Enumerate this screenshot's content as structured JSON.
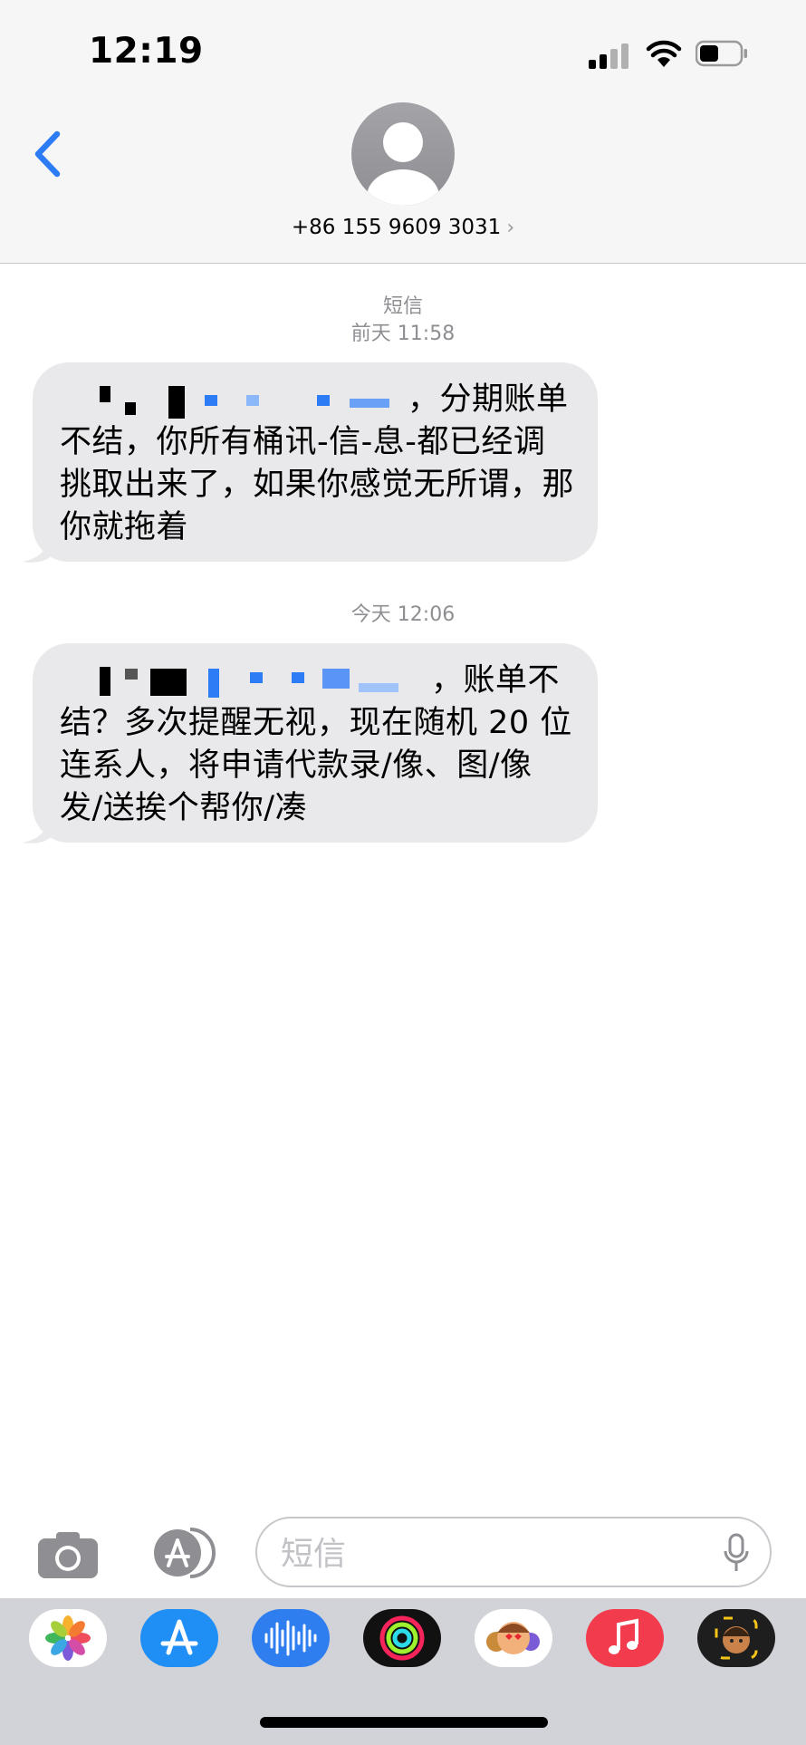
{
  "status_bar": {
    "time": "12:19"
  },
  "header": {
    "contact": "+86 155 9609 3031",
    "chevron": "›"
  },
  "thread": {
    "service_label": "短信",
    "groups": [
      {
        "timestamp": "前天 11:58",
        "message": "，分期账单不结，你所有桶讯-信-息-都已经调挑取出来了，如果你感觉无所谓，那你就拖着"
      },
      {
        "timestamp": "今天 12:06",
        "message": "，账单不结？多次提醒无视，现在随机 20 位连系人，将申请代款录/像、图/像发/送挨个帮你/凑"
      }
    ]
  },
  "input_bar": {
    "placeholder": "短信"
  },
  "dock": {
    "apps": [
      "photos-app-icon",
      "app-store-app-icon",
      "voice-memo-app-icon",
      "fitness-app-icon",
      "memoji-sticker-app-icon",
      "music-app-icon",
      "memoji-avatar-app-icon"
    ]
  },
  "colors": {
    "accent": "#2c7cf6",
    "bubble": "#e9e9eb",
    "timestamp": "#8e8e93",
    "header_bg": "#f6f6f6",
    "dock_bg": "#d1d3d8"
  }
}
